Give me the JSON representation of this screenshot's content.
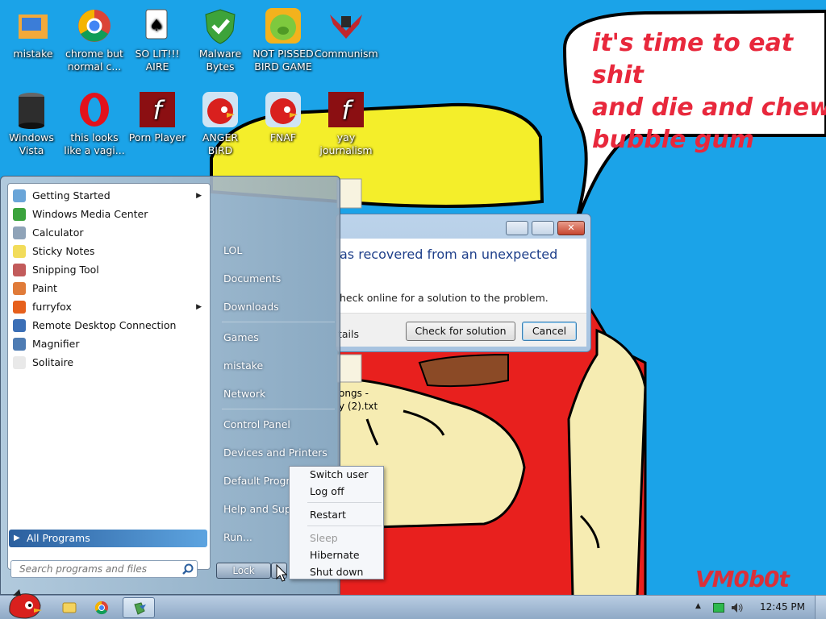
{
  "wallpaper": {
    "bubble_text": "it's time to eat shit\nand die and chew\nbubble gum",
    "signature": "VM0b0t"
  },
  "desktop_icons": [
    {
      "label": "mistake",
      "icon": "computer-box-icon"
    },
    {
      "label": "chrome but\nnormal c...",
      "icon": "chrome-icon"
    },
    {
      "label": "SO LIT!!!\nAIRE",
      "icon": "cards-icon"
    },
    {
      "label": "Malware\nBytes",
      "icon": "shield-check-icon"
    },
    {
      "label": "NOT PISSED\nBIRD GAME",
      "icon": "green-pig-icon"
    },
    {
      "label": "Communism",
      "icon": "emblem-icon"
    },
    {
      "label": "Windows\nVista",
      "icon": "trash-bin-icon"
    },
    {
      "label": "this looks\nlike a vagi...",
      "icon": "opera-icon"
    },
    {
      "label": "Porn Player",
      "icon": "flash-icon"
    },
    {
      "label": "ANGER\nBIRD",
      "icon": "red-bird-icon"
    },
    {
      "label": "FNAF",
      "icon": "red-bird-icon"
    },
    {
      "label": "yay\njournalism",
      "icon": "flash-icon"
    }
  ],
  "dialog": {
    "message": "as recovered from an unexpected",
    "hint": "heck online for a solution to the problem.",
    "details": "tails",
    "check_button": "Check for solution",
    "cancel_button": "Cancel"
  },
  "desktop_file": {
    "line1": "ongs -",
    "line2": "y (2).txt"
  },
  "start_menu": {
    "programs": [
      {
        "label": "Getting Started",
        "icon": "getting-started-icon",
        "submenu": true
      },
      {
        "label": "Windows Media Center",
        "icon": "media-center-icon",
        "submenu": false
      },
      {
        "label": "Calculator",
        "icon": "calculator-icon",
        "submenu": false
      },
      {
        "label": "Sticky Notes",
        "icon": "sticky-notes-icon",
        "submenu": false
      },
      {
        "label": "Snipping Tool",
        "icon": "scissors-icon",
        "submenu": false
      },
      {
        "label": "Paint",
        "icon": "paint-icon",
        "submenu": false
      },
      {
        "label": "furryfox",
        "icon": "firefox-icon",
        "submenu": true
      },
      {
        "label": "Remote Desktop Connection",
        "icon": "remote-desktop-icon",
        "submenu": false
      },
      {
        "label": "Magnifier",
        "icon": "magnifier-icon",
        "submenu": false
      },
      {
        "label": "Solitaire",
        "icon": "solitaire-icon",
        "submenu": false
      }
    ],
    "all_programs": "All Programs",
    "search_placeholder": "Search programs and files",
    "right_links": [
      "LOL",
      "Documents",
      "Downloads",
      "Games",
      "mistake",
      "Network",
      "Control Panel",
      "Devices and Printers",
      "Default Progra",
      "Help and Supp",
      "Run..."
    ],
    "lock_label": "Lock"
  },
  "power_menu": {
    "items": [
      "Switch user",
      "Log off",
      "Restart",
      "Sleep",
      "Hibernate",
      "Shut down"
    ]
  },
  "taskbar": {
    "clock": "12:45 PM"
  },
  "colors": {
    "desktop": "#1ba3e8",
    "bubble_text": "#e8283c"
  }
}
